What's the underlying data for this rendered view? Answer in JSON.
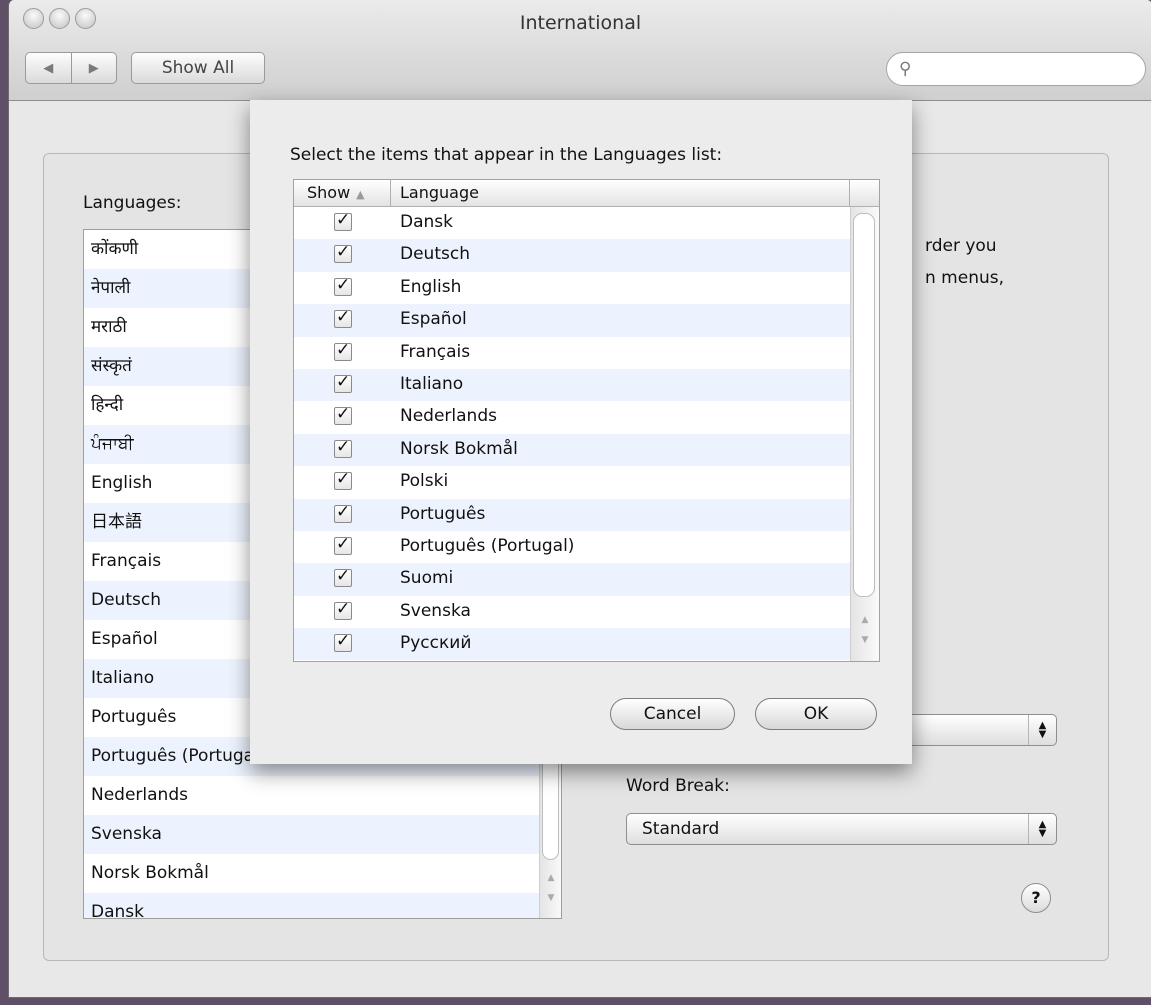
{
  "window": {
    "title": "International"
  },
  "toolbar": {
    "back": "◀",
    "forward": "▶",
    "show_all": "Show All",
    "search_placeholder": ""
  },
  "languages_panel": {
    "label": "Languages:",
    "items": [
      "कोंकणी",
      "नेपाली",
      "मराठी",
      "संस्कृतं",
      "हिन्दी",
      "ਪੰਜਾਬੀ",
      "English",
      "日本語",
      "Français",
      "Deutsch",
      "Español",
      "Italiano",
      "Português",
      "Português (Portugal)",
      "Nederlands",
      "Svenska",
      "Norsk Bokmål",
      "Dansk"
    ]
  },
  "right_panel": {
    "partial_line1": "rder you",
    "partial_line2": "n menus,",
    "word_break_label": "Word Break:",
    "word_break_value": "Standard",
    "help": "?"
  },
  "sheet": {
    "prompt": "Select the items that appear in the Languages list:",
    "col_show": "Show",
    "col_language": "Language",
    "rows": [
      {
        "language": "Dansk",
        "checked": true
      },
      {
        "language": "Deutsch",
        "checked": true
      },
      {
        "language": "English",
        "checked": true
      },
      {
        "language": "Español",
        "checked": true
      },
      {
        "language": "Français",
        "checked": true
      },
      {
        "language": "Italiano",
        "checked": true
      },
      {
        "language": "Nederlands",
        "checked": true
      },
      {
        "language": "Norsk Bokmål",
        "checked": true
      },
      {
        "language": "Polski",
        "checked": true
      },
      {
        "language": "Português",
        "checked": true
      },
      {
        "language": "Português (Portugal)",
        "checked": true
      },
      {
        "language": "Suomi",
        "checked": true
      },
      {
        "language": "Svenska",
        "checked": true
      },
      {
        "language": "Русский",
        "checked": true
      }
    ],
    "cancel": "Cancel",
    "ok": "OK"
  }
}
